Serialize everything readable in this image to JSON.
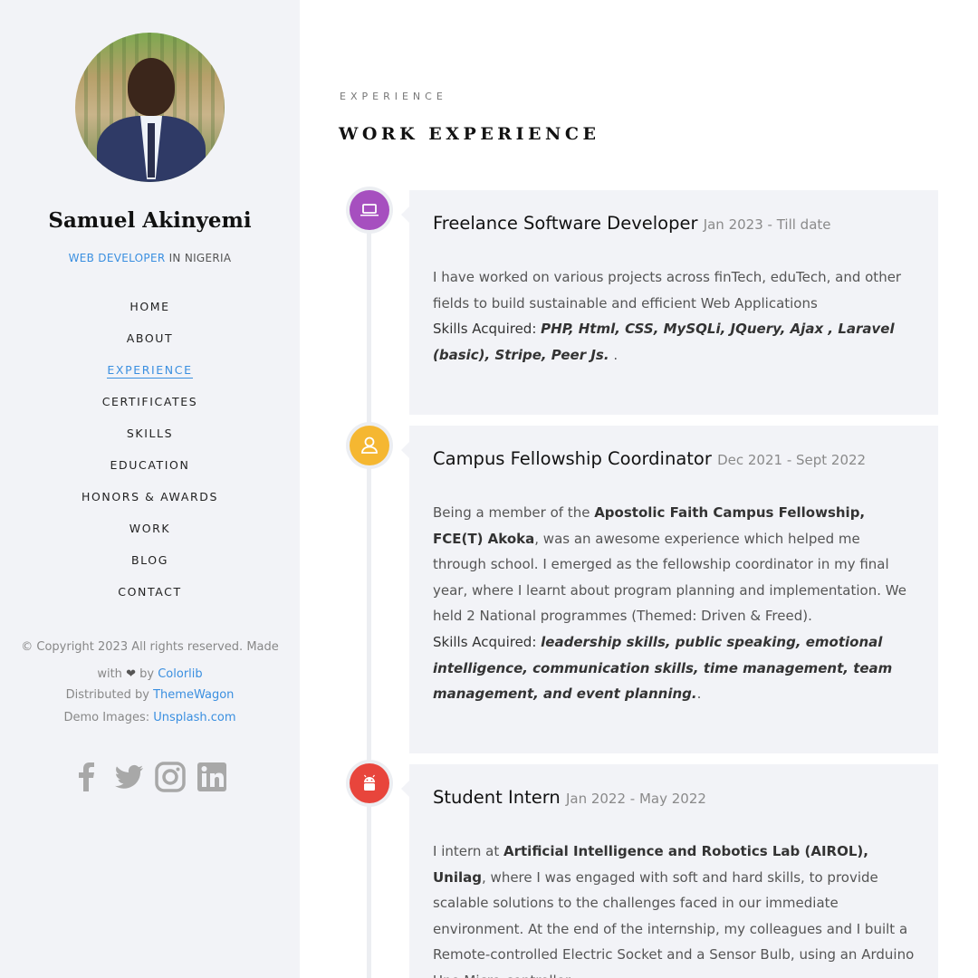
{
  "profile": {
    "name": "Samuel Akinyemi",
    "role_accent": "WEB DEVELOPER",
    "role_rest": " IN NIGERIA"
  },
  "nav": {
    "items": [
      {
        "label": "HOME"
      },
      {
        "label": "ABOUT"
      },
      {
        "label": "EXPERIENCE",
        "active": true
      },
      {
        "label": "CERTIFICATES"
      },
      {
        "label": "SKILLS"
      },
      {
        "label": "EDUCATION"
      },
      {
        "label": "HONORS & AWARDS"
      },
      {
        "label": "WORK"
      },
      {
        "label": "BLOG"
      },
      {
        "label": "CONTACT"
      }
    ]
  },
  "footer": {
    "copyright_line1": "© Copyright 2023 All rights reserved. Made",
    "copyright_with": "with",
    "heart": "❤",
    "copyright_by": "by",
    "colorlib": "Colorlib",
    "distributed_by": "Distributed by",
    "themewagon": "ThemeWagon",
    "demo_images": "Demo Images:",
    "unsplash": "Unsplash.com"
  },
  "social": [
    "facebook-icon",
    "twitter-icon",
    "instagram-icon",
    "linkedin-icon"
  ],
  "section": {
    "subtitle": "EXPERIENCE",
    "title": "WORK EXPERIENCE"
  },
  "colors": {
    "accent": "#3a8fe0",
    "icon_purple": "#a64fbf",
    "icon_yellow": "#f5b731",
    "icon_red": "#e8453c"
  },
  "experience": [
    {
      "title": "Freelance Software Developer",
      "date": "Jan 2023 - Till date",
      "icon": "laptop-icon",
      "text": "I have worked on various projects across finTech, eduTech, and other fields to build sustainable and efficient Web Applications",
      "skills_label": "Skills Acquired:",
      "skills": "PHP, Html, CSS, MySQLi, JQuery, Ajax , Laravel (basic), Stripe, Peer Js.",
      "skills_suffix": " ."
    },
    {
      "title": "Campus Fellowship Coordinator",
      "date": "Dec 2021 - Sept 2022",
      "icon": "user-icon",
      "text_pre": "Being a member of the ",
      "text_bold": "Apostolic Faith Campus Fellowship, FCE(T) Akoka",
      "text_post": ", was an awesome experience which helped me through school. I emerged as the fellowship coordinator in my final year, where I learnt about program planning and implementation. We held 2 National programmes (Themed: Driven & Freed).",
      "skills_label": "Skills Acquired:",
      "skills": "leadership skills, public speaking, emotional intelligence, communication skills, time management, team management, and event planning.",
      "skills_suffix": "."
    },
    {
      "title": "Student Intern",
      "date": "Jan 2022 - May 2022",
      "icon": "android-icon",
      "text_pre": "I intern at ",
      "text_bold": "Artificial Intelligence and Robotics Lab (AIROL), Unilag",
      "text_post": ", where I was engaged with soft and hard skills, to provide scalable solutions to the challenges faced in our immediate environment. At the end of the internship, my colleagues and I built a Remote-controlled Electric Socket and a Sensor Bulb, using an Arduino Uno Micro-controller."
    }
  ]
}
